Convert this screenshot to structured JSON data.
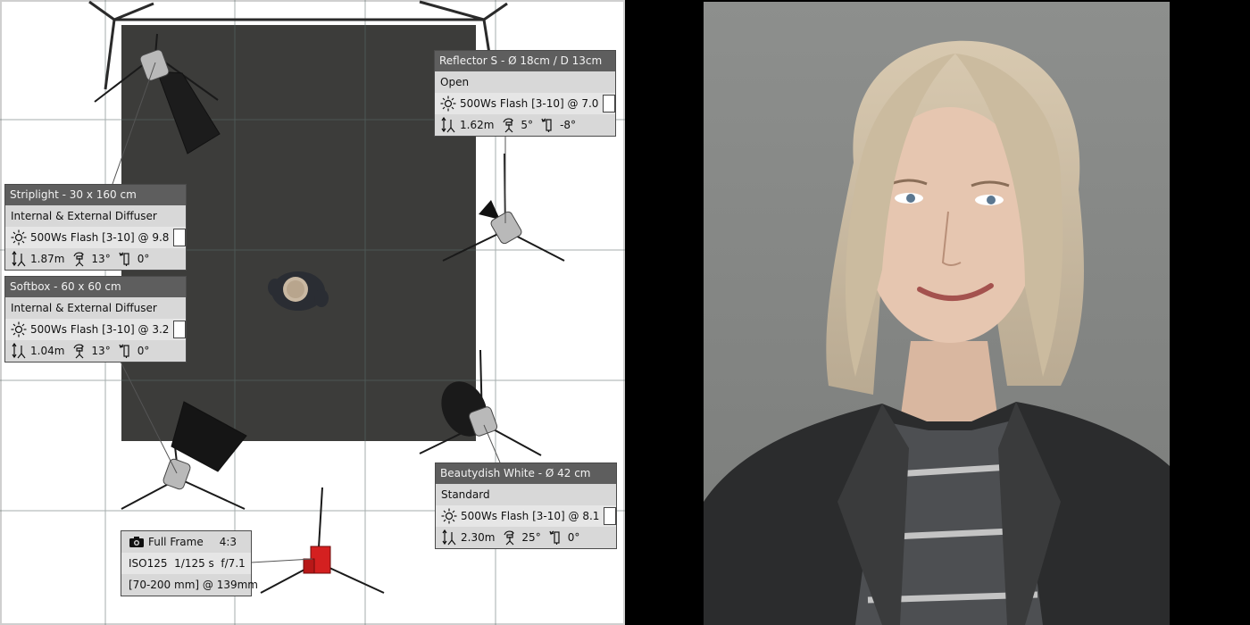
{
  "lights": [
    {
      "header": "Striplight - 30 x 160 cm",
      "modifier": "Internal & External Diffuser",
      "flash": "500Ws Flash [3-10] @ 9.8",
      "height": "1.87m",
      "tilt": "13°",
      "roll": "0°"
    },
    {
      "header": "Softbox - 60 x 60 cm",
      "modifier": "Internal & External Diffuser",
      "flash": "500Ws Flash [3-10] @ 3.2",
      "height": "1.04m",
      "tilt": "13°",
      "roll": "0°"
    },
    {
      "header": "Reflector S - Ø 18cm / D 13cm",
      "modifier": "Open",
      "flash": "500Ws Flash [3-10] @ 7.0",
      "height": "1.62m",
      "tilt": "5°",
      "roll": "-8°"
    },
    {
      "header": "Beautydish White - Ø 42 cm",
      "modifier": "Standard",
      "flash": "500Ws Flash [3-10] @ 8.1",
      "height": "2.30m",
      "tilt": "25°",
      "roll": "0°"
    }
  ],
  "camera": {
    "sensor": "Full Frame",
    "aspect": "4:3",
    "exposure": "ISO125  1/125 s  f/7.1",
    "lens": "[70-200 mm] @ 139mm"
  },
  "icons": {
    "flash": "sun-icon",
    "height": "height-stand-icon",
    "tilt": "tilt-icon",
    "roll": "roll-icon",
    "camera": "camera-icon",
    "color": "white-color-swatch"
  },
  "colors": {
    "panel_header": "#5e5e5e",
    "panel_body": "#d8d8d8",
    "backdrop": "#3c3c3a",
    "camera_body": "#d42020",
    "render_background": "#8a8c8a"
  }
}
